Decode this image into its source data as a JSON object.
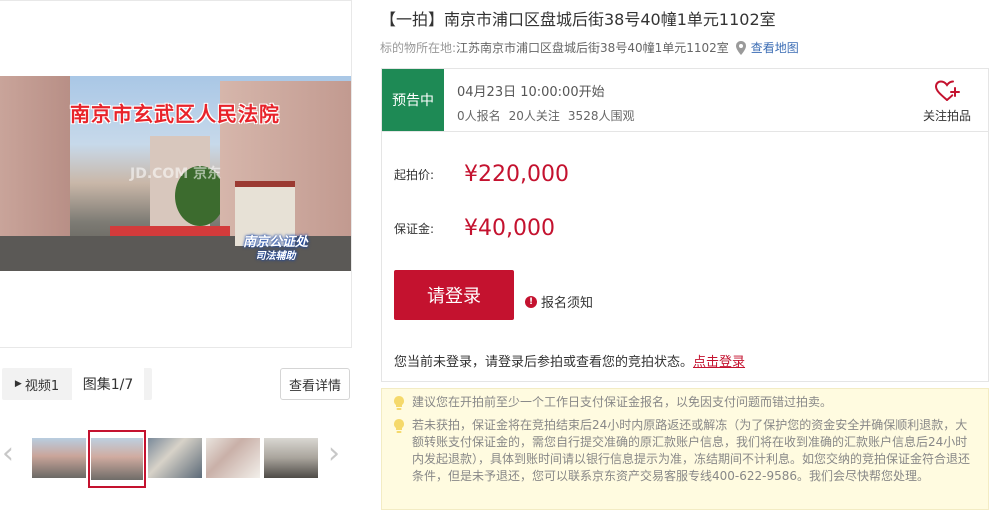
{
  "gallery": {
    "photo_caption": "南京市玄武区人民法院",
    "photo_watermark": "JD.COM 京东",
    "notary_label": "南京公证处",
    "notary_sub": "司法辅助",
    "tabs": [
      {
        "label": "视频1"
      },
      {
        "label": "图集1/7"
      }
    ],
    "detail_button": "查看详情",
    "thumb_count": 5,
    "selected_thumb": 2
  },
  "lot": {
    "title": "【一拍】南京市浦口区盘城后街38号40幢1单元1102室",
    "location_label": "标的物所在地:",
    "location_value": "江苏南京市浦口区盘城后街38号40幢1单元1102室",
    "map_link": "查看地图"
  },
  "status": {
    "badge": "预告中",
    "start_time": "04月23日 10:00:00开始",
    "registered": "0人报名",
    "followers": "20人关注",
    "viewers": "3528人围观",
    "follow_label": "关注拍品"
  },
  "prices": {
    "start_label": "起拍价:",
    "start_value": "¥220,000",
    "deposit_label": "保证金:",
    "deposit_value": "¥40,000"
  },
  "actions": {
    "login_button": "请登录",
    "notice_link": "报名须知",
    "login_hint": "您当前未登录，请登录后参拍或查看您的竞拍状态。",
    "login_link": "点击登录"
  },
  "tips": [
    "建议您在开拍前至少一个工作日支付保证金报名，以免因支付问题而错过拍卖。",
    "若未获拍，保证金将在竞拍结束后24小时内原路返还或解冻（为了保护您的资金安全并确保顺利退款，大额转账支付保证金的，需您自行提交准确的原汇款账户信息，我们将在收到准确的汇款账户信息后24小时内发起退款），具体到账时间请以银行信息提示为准，冻结期间不计利息。如您交纳的竞拍保证金符合退还条件，但是未予退还，您可以联系京东资产交易客服专线400-622-9586。我们会尽快帮您处理。"
  ],
  "colors": {
    "accent": "#c4122f",
    "status_green": "#1e8a55",
    "link_blue": "#3d6eb5",
    "tip_bg": "#fffbe0"
  }
}
